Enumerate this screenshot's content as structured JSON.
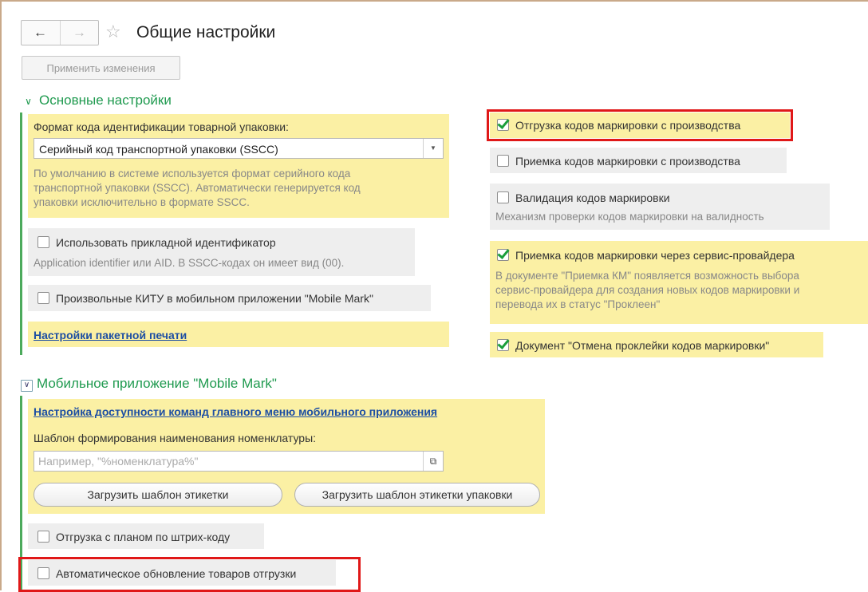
{
  "navigation": {
    "back_icon": "←",
    "forward_icon": "→",
    "star_icon": "☆"
  },
  "page": {
    "title": "Общие настройки",
    "apply_label": "Применить изменения"
  },
  "sections": {
    "main_title": "Основные настройки",
    "mobile_title": "Мобильное приложение \"Mobile Mark\""
  },
  "left_main": {
    "format_label": "Формат кода идентификации товарной упаковки:",
    "format_value": "Серийный код транспортной упаковки (SSCC)",
    "format_hint_1": "По умолчанию в системе используется формат серийного кода",
    "format_hint_2": "транспортной упаковки (SSCC). Автоматически генерируется код",
    "format_hint_3": "упаковки исключительно в формате SSCC.",
    "use_app_identifier_label": "Использовать прикладной идентификатор",
    "use_app_identifier_checked": false,
    "app_identifier_hint": "Application identifier или AID. В SSCC-кодах он имеет вид (00).",
    "arbitrary_kitu_label": "Произвольные КИТУ в мобильном приложении \"Mobile Mark\"",
    "arbitrary_kitu_checked": false,
    "batch_print_link": "Настройки пакетной печати"
  },
  "right_main": {
    "shipment_codes_label": "Отгрузка кодов маркировки с производства",
    "shipment_codes_checked": true,
    "receipt_codes_label": "Приемка кодов маркировки с производства",
    "receipt_codes_checked": false,
    "validation_label": "Валидация кодов маркировки",
    "validation_checked": false,
    "validation_hint": "Механизм проверки кодов маркировки на валидность",
    "provider_label": "Приемка кодов маркировки через сервис-провайдера",
    "provider_checked": true,
    "provider_hint_1": "В документе \"Приемка КМ\" появляется возможность выбора",
    "provider_hint_2": "сервис-провайдера для создания новых кодов маркировки и",
    "provider_hint_3": "перевода их в статус \"Проклеен\"",
    "cancel_doc_label": "Документ \"Отмена проклейки кодов маркировки\"",
    "cancel_doc_checked": true
  },
  "mobile": {
    "commands_link": "Настройка доступности команд главного меню мобильного приложения",
    "template_label": "Шаблон формирования наименования номенклатуры:",
    "template_placeholder": "Например, \"%номенклатура%\"",
    "load_label_template": "Загрузить шаблон этикетки",
    "load_package_template": "Загрузить шаблон этикетки упаковки",
    "shipment_plan_label": "Отгрузка с планом по штрих-коду",
    "shipment_plan_checked": false,
    "auto_update_label": "Автоматическое обновление товаров отгрузки",
    "auto_update_checked": false
  },
  "colors": {
    "accent_green": "#1f9a4f",
    "highlight_yellow": "#fbf0a4",
    "highlight_red": "#e01818",
    "link_blue": "#1d4ea3"
  }
}
